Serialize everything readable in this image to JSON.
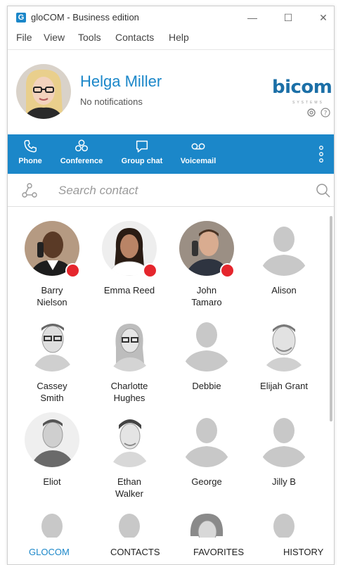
{
  "window": {
    "title": "gloCOM - Business edition",
    "app_icon_letter": "G",
    "controls": {
      "minimize": "—",
      "maximize": "☐",
      "close": "✕"
    }
  },
  "menu": [
    "File",
    "View",
    "Tools",
    "Contacts",
    "Help"
  ],
  "profile": {
    "name": "Helga Miller",
    "status": "No notifications",
    "brand": "bicom",
    "brand_sub": "SYSTEMS"
  },
  "toolbar": {
    "items": [
      {
        "label": "Phone",
        "icon": "phone-icon"
      },
      {
        "label": "Conference",
        "icon": "conference-icon"
      },
      {
        "label": "Group chat",
        "icon": "chat-icon"
      },
      {
        "label": "Voicemail",
        "icon": "voicemail-icon"
      }
    ],
    "more_icon": "more-vertical-icon"
  },
  "search": {
    "placeholder": "Search contact"
  },
  "contacts": [
    {
      "name": "Barry\nNielson",
      "on_call": true
    },
    {
      "name": "Emma Reed",
      "on_call": true
    },
    {
      "name": "John\nTamaro",
      "on_call": true
    },
    {
      "name": "Alison",
      "on_call": false
    },
    {
      "name": "Cassey\nSmith",
      "on_call": false
    },
    {
      "name": "Charlotte\nHughes",
      "on_call": false
    },
    {
      "name": "Debbie",
      "on_call": false
    },
    {
      "name": "Elijah Grant",
      "on_call": false
    },
    {
      "name": "Eliot",
      "on_call": false
    },
    {
      "name": "Ethan\nWalker",
      "on_call": false
    },
    {
      "name": "George",
      "on_call": false
    },
    {
      "name": "Jilly B",
      "on_call": false
    }
  ],
  "bottom_nav": [
    {
      "label": "GLOCOM",
      "active": true
    },
    {
      "label": "CONTACTS",
      "active": false
    },
    {
      "label": "FAVORITES",
      "active": false
    },
    {
      "label": "HISTORY",
      "active": false
    }
  ],
  "colors": {
    "accent": "#1b87c9",
    "status_busy": "#e5262d",
    "placeholder_avatar": "#c8c8c8"
  }
}
